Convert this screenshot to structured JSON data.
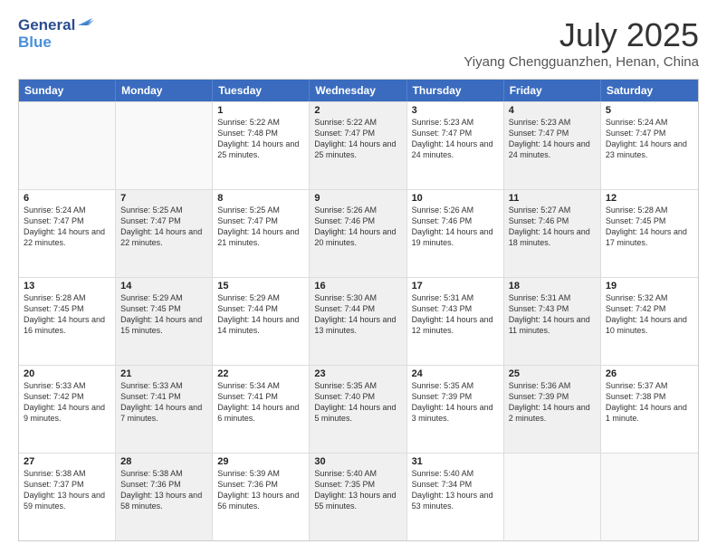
{
  "logo": {
    "line1": "General",
    "line2": "Blue"
  },
  "title": "July 2025",
  "location": "Yiyang Chengguanzhen, Henan, China",
  "days_of_week": [
    "Sunday",
    "Monday",
    "Tuesday",
    "Wednesday",
    "Thursday",
    "Friday",
    "Saturday"
  ],
  "weeks": [
    [
      {
        "day": "",
        "sunrise": "",
        "sunset": "",
        "daylight": "",
        "shaded": false,
        "empty": true
      },
      {
        "day": "",
        "sunrise": "",
        "sunset": "",
        "daylight": "",
        "shaded": false,
        "empty": true
      },
      {
        "day": "1",
        "sunrise": "Sunrise: 5:22 AM",
        "sunset": "Sunset: 7:48 PM",
        "daylight": "Daylight: 14 hours and 25 minutes.",
        "shaded": false,
        "empty": false
      },
      {
        "day": "2",
        "sunrise": "Sunrise: 5:22 AM",
        "sunset": "Sunset: 7:47 PM",
        "daylight": "Daylight: 14 hours and 25 minutes.",
        "shaded": true,
        "empty": false
      },
      {
        "day": "3",
        "sunrise": "Sunrise: 5:23 AM",
        "sunset": "Sunset: 7:47 PM",
        "daylight": "Daylight: 14 hours and 24 minutes.",
        "shaded": false,
        "empty": false
      },
      {
        "day": "4",
        "sunrise": "Sunrise: 5:23 AM",
        "sunset": "Sunset: 7:47 PM",
        "daylight": "Daylight: 14 hours and 24 minutes.",
        "shaded": true,
        "empty": false
      },
      {
        "day": "5",
        "sunrise": "Sunrise: 5:24 AM",
        "sunset": "Sunset: 7:47 PM",
        "daylight": "Daylight: 14 hours and 23 minutes.",
        "shaded": false,
        "empty": false
      }
    ],
    [
      {
        "day": "6",
        "sunrise": "Sunrise: 5:24 AM",
        "sunset": "Sunset: 7:47 PM",
        "daylight": "Daylight: 14 hours and 22 minutes.",
        "shaded": false,
        "empty": false
      },
      {
        "day": "7",
        "sunrise": "Sunrise: 5:25 AM",
        "sunset": "Sunset: 7:47 PM",
        "daylight": "Daylight: 14 hours and 22 minutes.",
        "shaded": true,
        "empty": false
      },
      {
        "day": "8",
        "sunrise": "Sunrise: 5:25 AM",
        "sunset": "Sunset: 7:47 PM",
        "daylight": "Daylight: 14 hours and 21 minutes.",
        "shaded": false,
        "empty": false
      },
      {
        "day": "9",
        "sunrise": "Sunrise: 5:26 AM",
        "sunset": "Sunset: 7:46 PM",
        "daylight": "Daylight: 14 hours and 20 minutes.",
        "shaded": true,
        "empty": false
      },
      {
        "day": "10",
        "sunrise": "Sunrise: 5:26 AM",
        "sunset": "Sunset: 7:46 PM",
        "daylight": "Daylight: 14 hours and 19 minutes.",
        "shaded": false,
        "empty": false
      },
      {
        "day": "11",
        "sunrise": "Sunrise: 5:27 AM",
        "sunset": "Sunset: 7:46 PM",
        "daylight": "Daylight: 14 hours and 18 minutes.",
        "shaded": true,
        "empty": false
      },
      {
        "day": "12",
        "sunrise": "Sunrise: 5:28 AM",
        "sunset": "Sunset: 7:45 PM",
        "daylight": "Daylight: 14 hours and 17 minutes.",
        "shaded": false,
        "empty": false
      }
    ],
    [
      {
        "day": "13",
        "sunrise": "Sunrise: 5:28 AM",
        "sunset": "Sunset: 7:45 PM",
        "daylight": "Daylight: 14 hours and 16 minutes.",
        "shaded": false,
        "empty": false
      },
      {
        "day": "14",
        "sunrise": "Sunrise: 5:29 AM",
        "sunset": "Sunset: 7:45 PM",
        "daylight": "Daylight: 14 hours and 15 minutes.",
        "shaded": true,
        "empty": false
      },
      {
        "day": "15",
        "sunrise": "Sunrise: 5:29 AM",
        "sunset": "Sunset: 7:44 PM",
        "daylight": "Daylight: 14 hours and 14 minutes.",
        "shaded": false,
        "empty": false
      },
      {
        "day": "16",
        "sunrise": "Sunrise: 5:30 AM",
        "sunset": "Sunset: 7:44 PM",
        "daylight": "Daylight: 14 hours and 13 minutes.",
        "shaded": true,
        "empty": false
      },
      {
        "day": "17",
        "sunrise": "Sunrise: 5:31 AM",
        "sunset": "Sunset: 7:43 PM",
        "daylight": "Daylight: 14 hours and 12 minutes.",
        "shaded": false,
        "empty": false
      },
      {
        "day": "18",
        "sunrise": "Sunrise: 5:31 AM",
        "sunset": "Sunset: 7:43 PM",
        "daylight": "Daylight: 14 hours and 11 minutes.",
        "shaded": true,
        "empty": false
      },
      {
        "day": "19",
        "sunrise": "Sunrise: 5:32 AM",
        "sunset": "Sunset: 7:42 PM",
        "daylight": "Daylight: 14 hours and 10 minutes.",
        "shaded": false,
        "empty": false
      }
    ],
    [
      {
        "day": "20",
        "sunrise": "Sunrise: 5:33 AM",
        "sunset": "Sunset: 7:42 PM",
        "daylight": "Daylight: 14 hours and 9 minutes.",
        "shaded": false,
        "empty": false
      },
      {
        "day": "21",
        "sunrise": "Sunrise: 5:33 AM",
        "sunset": "Sunset: 7:41 PM",
        "daylight": "Daylight: 14 hours and 7 minutes.",
        "shaded": true,
        "empty": false
      },
      {
        "day": "22",
        "sunrise": "Sunrise: 5:34 AM",
        "sunset": "Sunset: 7:41 PM",
        "daylight": "Daylight: 14 hours and 6 minutes.",
        "shaded": false,
        "empty": false
      },
      {
        "day": "23",
        "sunrise": "Sunrise: 5:35 AM",
        "sunset": "Sunset: 7:40 PM",
        "daylight": "Daylight: 14 hours and 5 minutes.",
        "shaded": true,
        "empty": false
      },
      {
        "day": "24",
        "sunrise": "Sunrise: 5:35 AM",
        "sunset": "Sunset: 7:39 PM",
        "daylight": "Daylight: 14 hours and 3 minutes.",
        "shaded": false,
        "empty": false
      },
      {
        "day": "25",
        "sunrise": "Sunrise: 5:36 AM",
        "sunset": "Sunset: 7:39 PM",
        "daylight": "Daylight: 14 hours and 2 minutes.",
        "shaded": true,
        "empty": false
      },
      {
        "day": "26",
        "sunrise": "Sunrise: 5:37 AM",
        "sunset": "Sunset: 7:38 PM",
        "daylight": "Daylight: 14 hours and 1 minute.",
        "shaded": false,
        "empty": false
      }
    ],
    [
      {
        "day": "27",
        "sunrise": "Sunrise: 5:38 AM",
        "sunset": "Sunset: 7:37 PM",
        "daylight": "Daylight: 13 hours and 59 minutes.",
        "shaded": false,
        "empty": false
      },
      {
        "day": "28",
        "sunrise": "Sunrise: 5:38 AM",
        "sunset": "Sunset: 7:36 PM",
        "daylight": "Daylight: 13 hours and 58 minutes.",
        "shaded": true,
        "empty": false
      },
      {
        "day": "29",
        "sunrise": "Sunrise: 5:39 AM",
        "sunset": "Sunset: 7:36 PM",
        "daylight": "Daylight: 13 hours and 56 minutes.",
        "shaded": false,
        "empty": false
      },
      {
        "day": "30",
        "sunrise": "Sunrise: 5:40 AM",
        "sunset": "Sunset: 7:35 PM",
        "daylight": "Daylight: 13 hours and 55 minutes.",
        "shaded": true,
        "empty": false
      },
      {
        "day": "31",
        "sunrise": "Sunrise: 5:40 AM",
        "sunset": "Sunset: 7:34 PM",
        "daylight": "Daylight: 13 hours and 53 minutes.",
        "shaded": false,
        "empty": false
      },
      {
        "day": "",
        "sunrise": "",
        "sunset": "",
        "daylight": "",
        "shaded": false,
        "empty": true
      },
      {
        "day": "",
        "sunrise": "",
        "sunset": "",
        "daylight": "",
        "shaded": false,
        "empty": true
      }
    ]
  ]
}
